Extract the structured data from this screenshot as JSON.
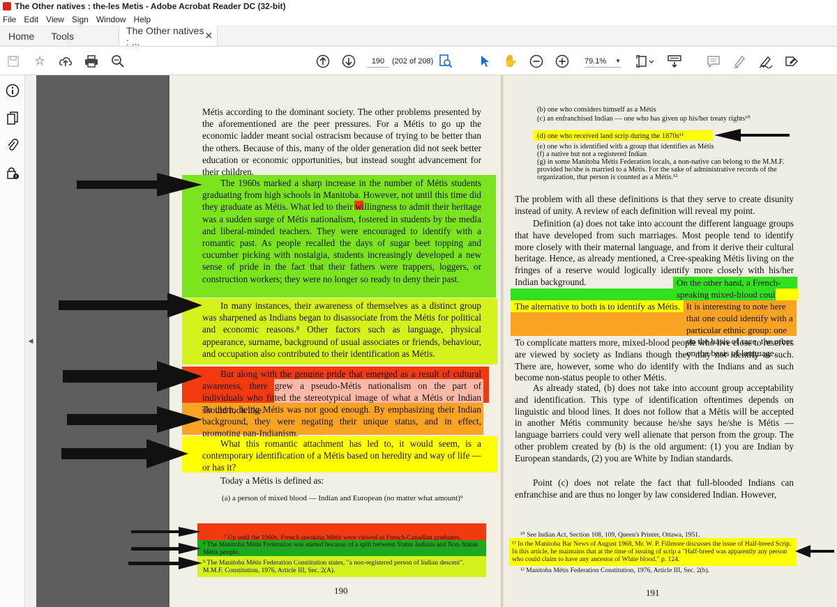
{
  "window": {
    "title": "The Other natives : the-les Metis - Adobe Acrobat Reader DC (32-bit)"
  },
  "menu": [
    "File",
    "Edit",
    "View",
    "Sign",
    "Window",
    "Help"
  ],
  "tabs": {
    "home": "Home",
    "tools": "Tools",
    "document": "The Other natives : ..."
  },
  "toolbar": {
    "page_value": "190",
    "page_count": "(202 of 208)",
    "zoom": "79.1%",
    "icons": [
      "save-icon",
      "bookmark-star-icon",
      "upload-icon",
      "print-icon",
      "search-zoom-icon",
      "page-up-icon",
      "page-down-icon",
      "find-icon",
      "select-pointer-icon",
      "hand-icon",
      "zoom-out-icon",
      "zoom-in-icon",
      "page-fit-icon",
      "read-mode-icon",
      "comment-icon",
      "highlight-pen-icon",
      "sign-icon",
      "fill-sign-icon"
    ]
  },
  "left_panel": {
    "icons": [
      "info-icon",
      "pages-icon",
      "attachment-icon",
      "security-icon"
    ]
  },
  "highlight_colors": {
    "green": "#7be41f",
    "yellow_green": "#d6f21c",
    "red": "#f23a10",
    "orange": "#f9a323",
    "yellow": "#ffff00",
    "dark_green": "#1ea81e"
  },
  "left_page": {
    "intro": "Métis according to the dominant society. The other problems presented by the aforementioned are the peer pressures. For a Métis to go up the economic ladder meant social ostracism because of trying to be better than the others. Because of this, many of the older generation did not seek better education or economic opportunities, but instead sought advancement for their children.",
    "p1960s": "The 1960s marked a sharp increase in the number of Métis students graduating from high schools in Manitoba. However, not until this time did they graduate as Métis. What led to their willingness to admit their heritage was a sudden surge of Métis nationalism, fostered in students by the media and liberal-minded teachers. They were encouraged to identify with a romantic past. As people recalled the days of sugar beet topping and cucumber picking with nostalgia, students increasingly developed a new sense of pride in the fact that their fathers were trappers, loggers, or construction workers; they were no longer so ready to deny their past.",
    "pinstances": "In many instances, their awareness of themselves as a distinct group was sharpened as Indians began to disassociate from the Métis for political and economic reasons.⁸ Other factors such as language, physical appearance, surname, background of usual associates or friends, behaviour, and occupation also contributed to their identification as Métis.",
    "ppride_red": "But along with the genuine pride that emerged as a result of cultural awareness, there grew a pseudo-Métis nationalism on the part of individuals who fitted the stereotypical image of what a Métis or Indian should look like.",
    "ppride_orange": "To them, being Métis was not good enough. By emphasizing their Indian background, they were negating their unique status, and in effect, promoting pan-Indianism.",
    "promantic": "What this romantic attachment has led to, it would seem, is a contemporary identification of a Métis based on heredity and way of life — or has it?",
    "today": "Today a Métis is defined as:",
    "defa": "(a) a person of mixed blood — Indian and European (no matter what amount)⁹",
    "fn7": "⁷ Up until the 1960s, French speaking Métis were viewed as French-Canadian graduates.",
    "fn8": "⁸ The Manitoba Métis Federation was started because of a split between Status Indians and Non-Status Métis people.",
    "fn9": "⁹ The Manitoba Métis Federation Constitution states, \"a non-registered person of Indian descent\". M.M.F. Constitution, 1976, Article III, Sec. 2(A).",
    "page_number": "190"
  },
  "right_page": {
    "defb": "(b) one who considers himself as a Métis",
    "defc": "(c) an enfranchised Indian — one who has given up his/her treaty rights¹⁰",
    "defd": "(d) one who received land scrip during the 1870s¹¹",
    "defe": "(e) one who is identified with a group that identifies as Métis",
    "deff": "(f) a native but not a registered Indian",
    "defg": "(g) in some Manitoba Métis Federation locals, a non-native can belong to the M.M.F. provided he/she is married to a Métis. For the sake of administrative records of the organization, that person is counted as a Métis.¹²",
    "pproblem": "The problem with all these definitions is that they serve to create disunity instead of unity. A review of each definition will reveal my point.",
    "pdefa": "Definition (a) does not take into account the different language groups that have developed from such marriages. Most people tend to identify more closely with their maternal language, and from it derive their cultural heritage. Hence, as already mentioned, a Cree-speaking Métis living on the fringes of a reserve would logically identify more closely with his/her Indian background.",
    "hl_green": "On the other hand, a French-speaking mixed-blood could identify with the French-Canadians.",
    "hl_yellow": "The alternative to both is to identify as Métis.",
    "hl_orange": "It is interesting to note here that one could identify with a particular ethnic group: one on the basis of race, the other on the basis of language.",
    "pcomplicate": "To complicate matters more, mixed-blood people who live close to reserves are viewed by society as Indians though they may not identify as such. There are, however, some who do identify with the Indians and as such become non-status people to other Métis.",
    "pstated": "As already stated, (b) does not take into account group acceptability and identification. This type of identification oftentimes depends on linguistic and blood lines. It does not follow that a Métis will be accepted in another Métis community because he/she says he/she is Métis — language barriers could very well alienate that person from the group. The other problem created by (b) is the old argument: (1) you are Indian by European standards, (2) you are White by Indian standards.",
    "pointc": "Point (c) does not relate the fact that full-blooded Indians can enfranchise and are thus no longer by law considered Indian. However,",
    "fn10": "¹⁰ See Indian Act, Section 108, 109, Queen's Printer, Ottawa, 1951.",
    "fn11": "¹¹ In the Manitoba Bar News of August 1968, Mr. W. P. Fillmore discusses the issue of Half-breed Scrip. In this article, he maintains that at the time of issuing of scrip a \"Half-breed was apparently any person who could claim to have any ancestor of White blood.\" p. 124.",
    "fn12": "¹² Manitoba Métis Federation Constitution, 1976, Article III, Sec. 2(b).",
    "page_number": "191"
  }
}
